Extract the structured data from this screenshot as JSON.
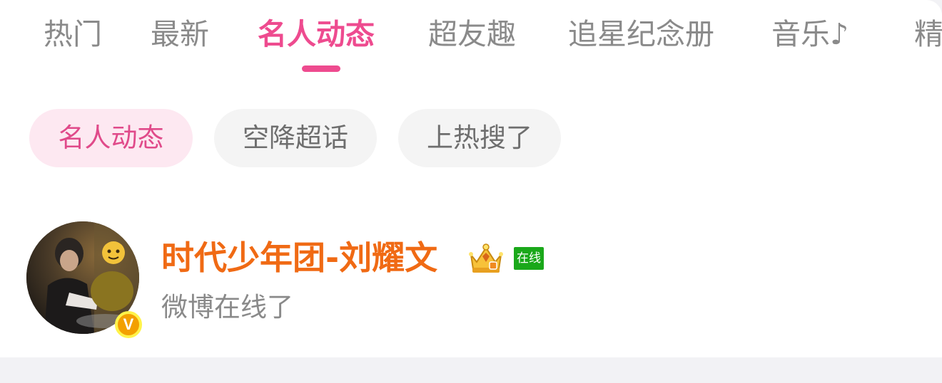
{
  "tabs": [
    {
      "label": "热门"
    },
    {
      "label": "最新"
    },
    {
      "label": "名人动态"
    },
    {
      "label": "超友趣"
    },
    {
      "label": "追星纪念册"
    },
    {
      "label": "音乐♪"
    },
    {
      "label": "精"
    }
  ],
  "active_tab": "名人动态",
  "chips": [
    {
      "label": "名人动态"
    },
    {
      "label": "空降超话"
    },
    {
      "label": "上热搜了"
    }
  ],
  "active_chip": "名人动态",
  "post": {
    "username": "时代少年团-刘耀文",
    "online_badge": "在线",
    "verified_mark": "V",
    "text": "微博在线了"
  },
  "colors": {
    "accent": "#ee4b8f",
    "chip_active_bg": "#fde8f1",
    "username": "#f06a14",
    "online_badge": "#1aa81a",
    "verified": "#f3a000"
  },
  "icons": [
    "crown-icon",
    "verified-icon",
    "avatar"
  ]
}
